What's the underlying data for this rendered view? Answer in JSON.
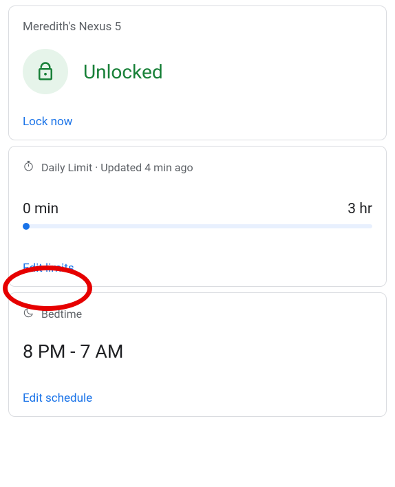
{
  "device_card": {
    "title": "Meredith's Nexus 5",
    "status": "Unlocked",
    "action": "Lock now"
  },
  "daily_limit_card": {
    "header": "Daily Limit · Updated 4 min ago",
    "current": "0 min",
    "max": "3 hr",
    "action": "Edit limits"
  },
  "bedtime_card": {
    "header": "Bedtime",
    "range": "8 PM - 7 AM",
    "action": "Edit schedule"
  }
}
